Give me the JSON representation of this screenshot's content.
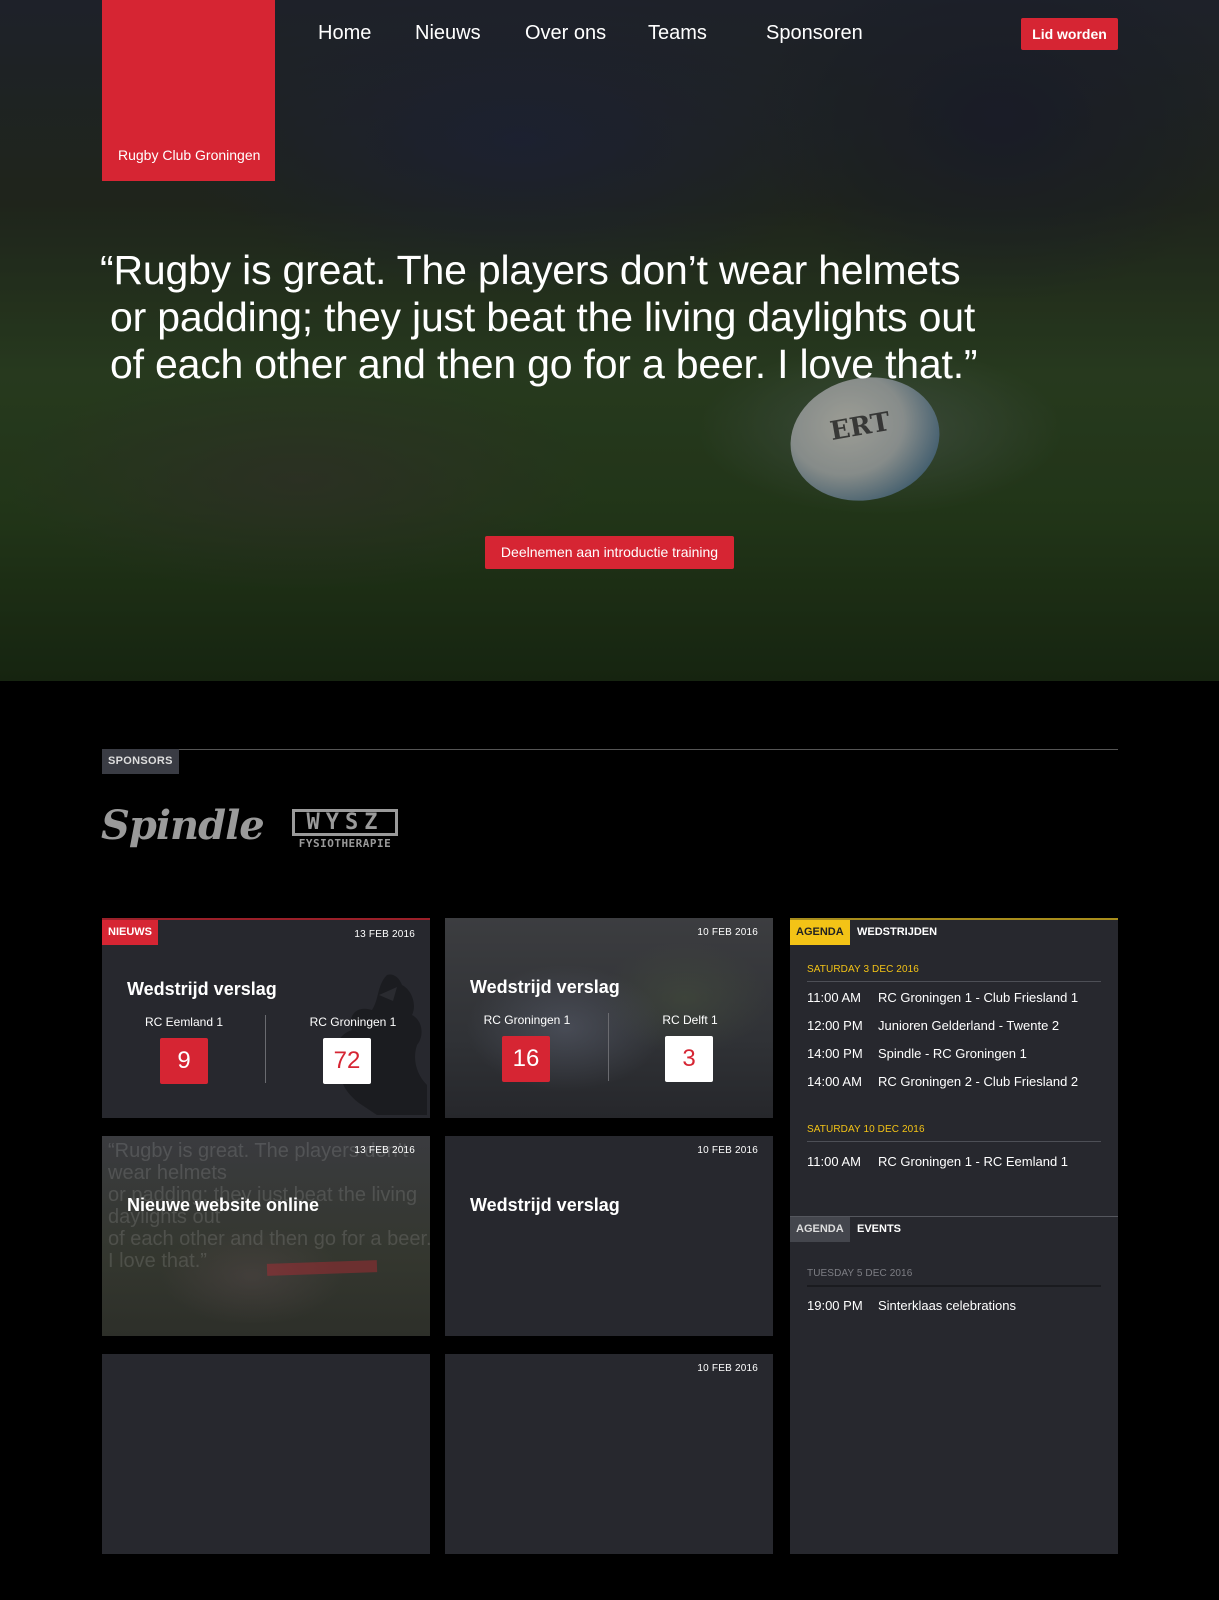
{
  "brand": {
    "name": "Rugby Club Groningen",
    "accent": "#d62533",
    "agenda_accent": "#f3c316"
  },
  "nav": {
    "items": [
      "Home",
      "Nieuws",
      "Over ons",
      "Teams",
      "Sponsoren"
    ],
    "join_label": "Lid worden"
  },
  "hero": {
    "quote_lines": [
      "“Rugby is great. The players don’t wear helmets",
      "or padding; they just beat the living daylights out",
      "of each other and then go for a beer. I love that.”"
    ],
    "cta_label": "Deelnemen aan introductie training",
    "ball_text": "ERT"
  },
  "sponsors": {
    "label": "SPONSORS",
    "logos": [
      {
        "name": "Spindle"
      },
      {
        "name": "WYSZ",
        "sub": "FYSIOTHERAPIE"
      }
    ]
  },
  "news": {
    "tag": "NIEUWS",
    "cards": [
      {
        "date": "13 FEB 2016",
        "title": "Wedstrijd verslag",
        "home_team": "RC Eemland 1",
        "home_score": "9",
        "away_team": "RC Groningen 1",
        "away_score": "72"
      },
      {
        "date": "10 FEB 2016",
        "title": "Wedstrijd verslag",
        "home_team": "RC Groningen 1",
        "home_score": "16",
        "away_team": "RC Delft 1",
        "away_score": "3"
      },
      {
        "date": "13 FEB 2016",
        "title": "Nieuwe website online"
      },
      {
        "date": "10 FEB 2016",
        "title": "Wedstrijd verslag"
      },
      {
        "date": ""
      },
      {
        "date": "10 FEB 2016"
      }
    ]
  },
  "agenda": {
    "matches": {
      "tab_active": "AGENDA",
      "tab_label": "WEDSTRIJDEN",
      "days": [
        {
          "day": "SATURDAY 3 DEC 2016",
          "events": [
            {
              "time": "11:00 AM",
              "title": "RC Groningen 1 - Club Friesland 1"
            },
            {
              "time": "12:00 PM",
              "title": "Junioren Gelderland - Twente 2"
            },
            {
              "time": "14:00 PM",
              "title": "Spindle - RC Groningen 1"
            },
            {
              "time": "14:00 AM",
              "title": "RC Groningen 2 - Club Friesland 2"
            }
          ]
        },
        {
          "day": "SATURDAY 10 DEC 2016",
          "events": [
            {
              "time": "11:00 AM",
              "title": "RC Groningen 1 - RC Eemland 1"
            }
          ]
        }
      ]
    },
    "events": {
      "tab_active": "AGENDA",
      "tab_label": "EVENTS",
      "days": [
        {
          "day": "TUESDAY 5 DEC 2016",
          "events": [
            {
              "time": "19:00 PM",
              "title": "Sinterklaas celebrations"
            }
          ]
        }
      ]
    }
  }
}
